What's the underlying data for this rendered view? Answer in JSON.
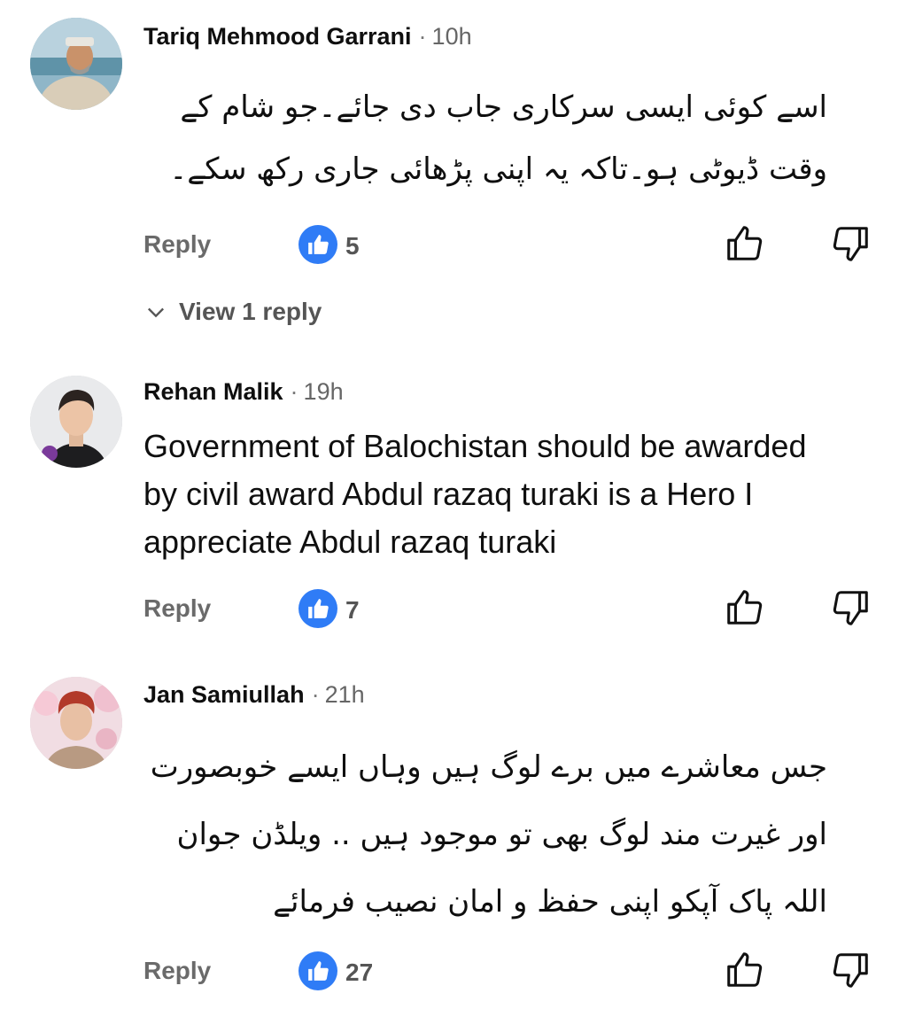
{
  "comments": [
    {
      "author": "Tariq Mehmood Garrani",
      "time": "10h",
      "text": "اسے کوئی ایسی سرکاری جاب دی جائے۔جو شام کے وقت ڈیوٹی ہو۔تاکہ یہ اپنی پڑھائی جاری رکھ سکے۔",
      "reply_label": "Reply",
      "likes": "5",
      "view_replies_label": "View 1 reply"
    },
    {
      "author": "Rehan Malik",
      "time": "19h",
      "text": "Government of Balochistan should be awarded by civil award Abdul razaq turaki is a Hero I appreciate Abdul razaq turaki",
      "reply_label": "Reply",
      "likes": "7"
    },
    {
      "author": "Jan Samiullah",
      "time": "21h",
      "text": "جس معاشرے میں برے لوگ ہیں وہاں ایسے خوبصورت اور غیرت مند لوگ بھی تو موجود ہیں .. ویلڈن جوان اللہ پاک آپکو اپنی حفظ و امان نصیب فرمائے",
      "reply_label": "Reply",
      "likes": "27"
    }
  ],
  "colors": {
    "like_badge": "#2f7cf6",
    "meta_text": "#666666",
    "action_text": "#6a6a6a"
  },
  "icons": {
    "like": "thumbs-up-icon",
    "dislike": "thumbs-down-icon",
    "expand": "chevron-down-icon"
  }
}
